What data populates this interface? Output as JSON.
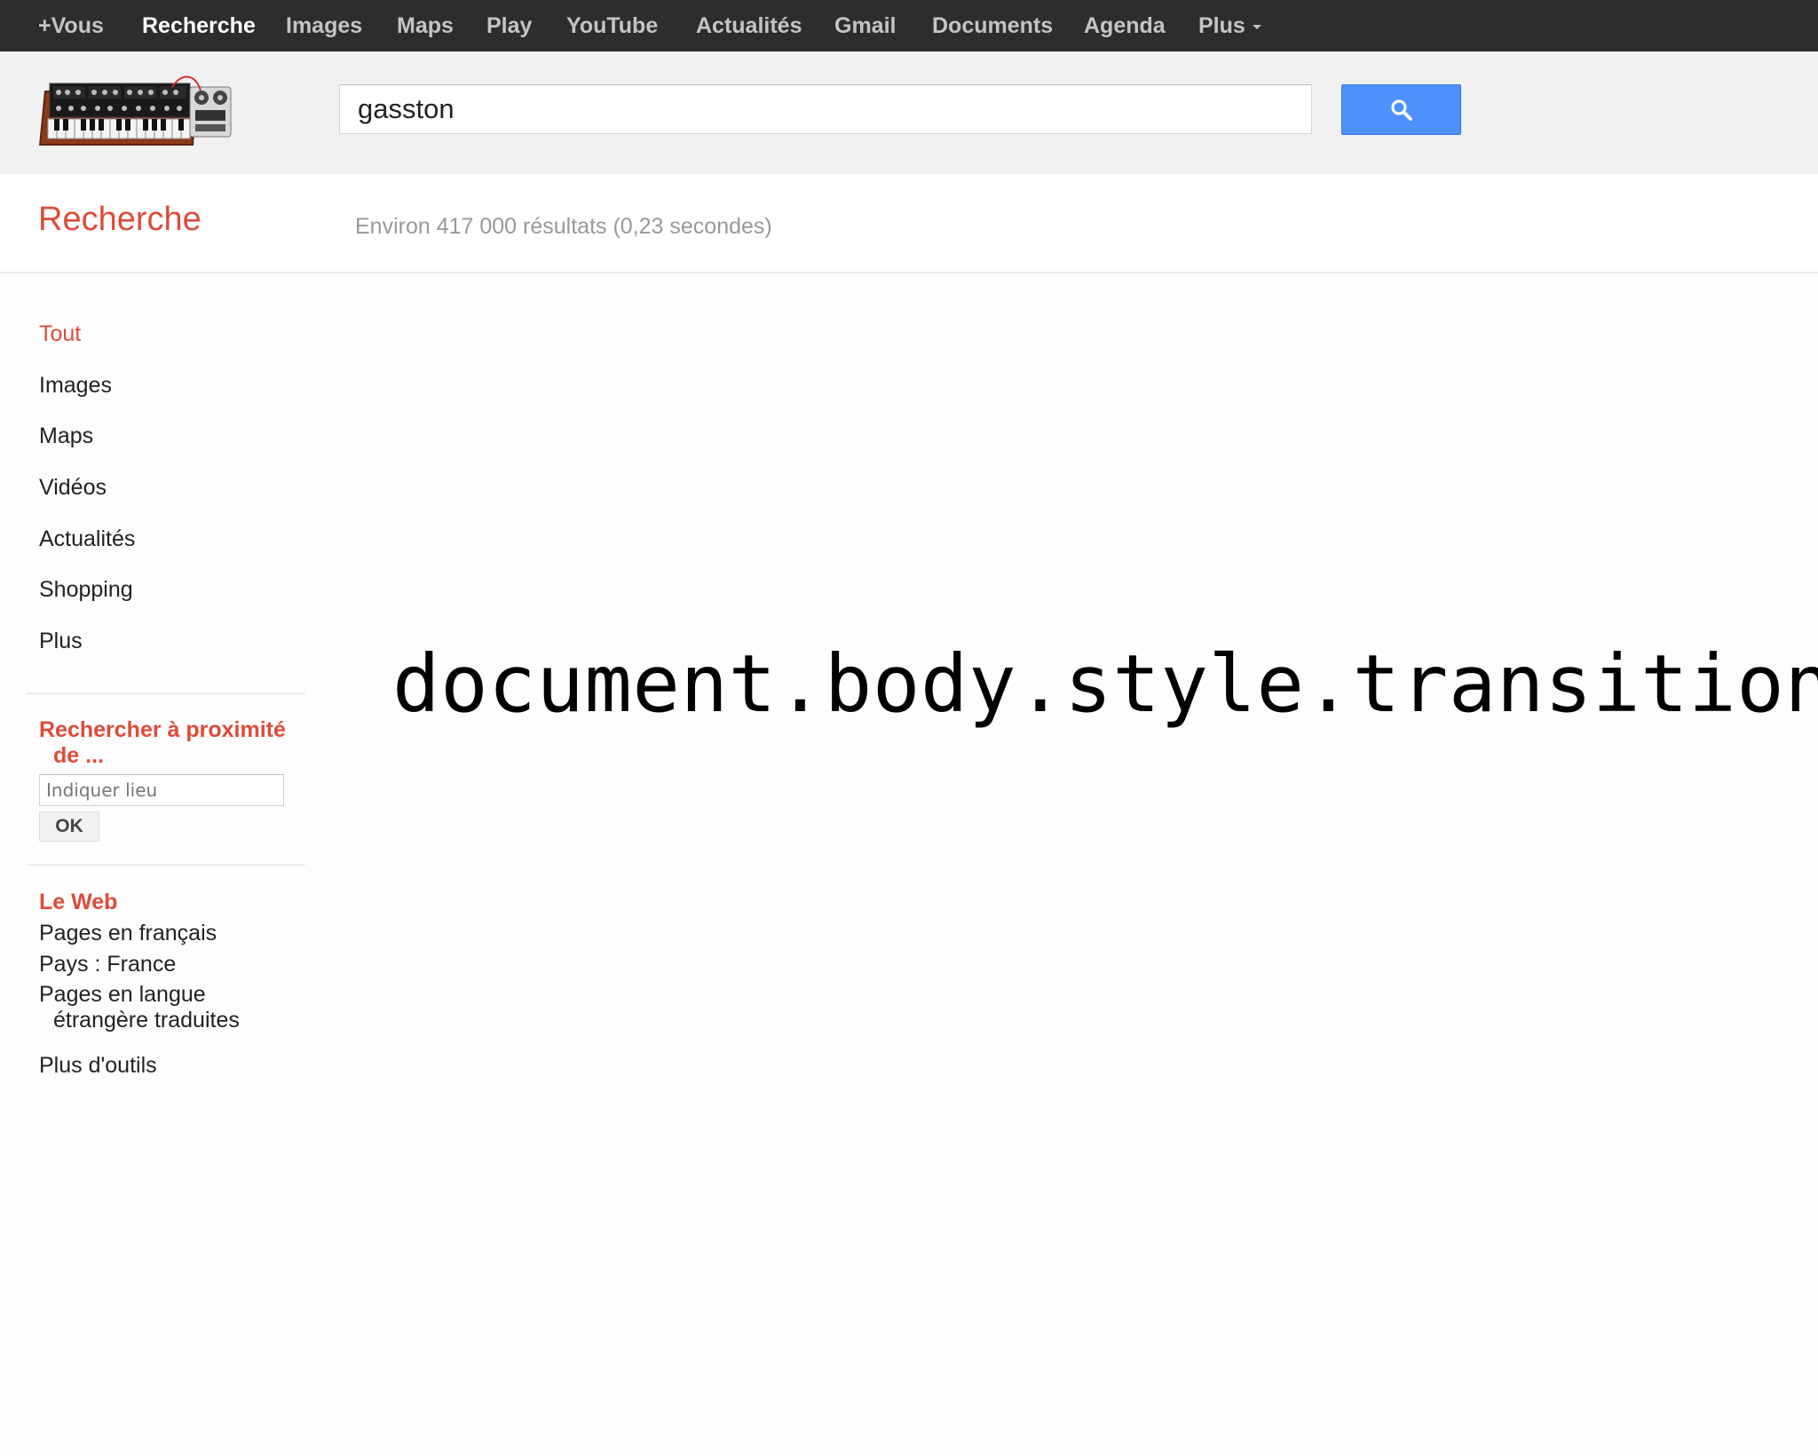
{
  "topbar": {
    "items": [
      {
        "label": "+Vous",
        "active": false
      },
      {
        "label": "Recherche",
        "active": true
      },
      {
        "label": "Images",
        "active": false
      },
      {
        "label": "Maps",
        "active": false
      },
      {
        "label": "Play",
        "active": false
      },
      {
        "label": "YouTube",
        "active": false
      },
      {
        "label": "Actualités",
        "active": false
      },
      {
        "label": "Gmail",
        "active": false
      },
      {
        "label": "Documents",
        "active": false
      },
      {
        "label": "Agenda",
        "active": false
      },
      {
        "label": "Plus",
        "active": false,
        "dropdown": true
      }
    ]
  },
  "header": {
    "logo_icon": "synthesizer-icon",
    "search": {
      "value": "gasston"
    },
    "search_button_icon": "search-icon"
  },
  "results": {
    "section_title": "Recherche",
    "stats": "Environ 417 000 résultats (0,23 secondes)"
  },
  "sidebar": {
    "nav_items": [
      {
        "label": "Tout",
        "active": true
      },
      {
        "label": "Images",
        "active": false
      },
      {
        "label": "Maps",
        "active": false
      },
      {
        "label": "Vidéos",
        "active": false
      },
      {
        "label": "Actualités",
        "active": false
      },
      {
        "label": "Shopping",
        "active": false
      },
      {
        "label": "Plus",
        "active": false
      }
    ],
    "location": {
      "heading_line1": "Rechercher à proximité",
      "heading_line2": "de ...",
      "placeholder": "Indiquer lieu",
      "ok_label": "OK"
    },
    "web": {
      "heading": "Le Web",
      "items": [
        "Pages en français",
        "Pays : France"
      ],
      "translated_line1": "Pages en langue",
      "translated_line2": "étrangère traduites",
      "tools": "Plus d'outils"
    }
  },
  "overlay": {
    "code": "document.body.style.transition"
  },
  "colors": {
    "accent_red": "#dd4b39",
    "topbar_bg": "#2d2d2d",
    "search_blue": "#4d90fe"
  }
}
